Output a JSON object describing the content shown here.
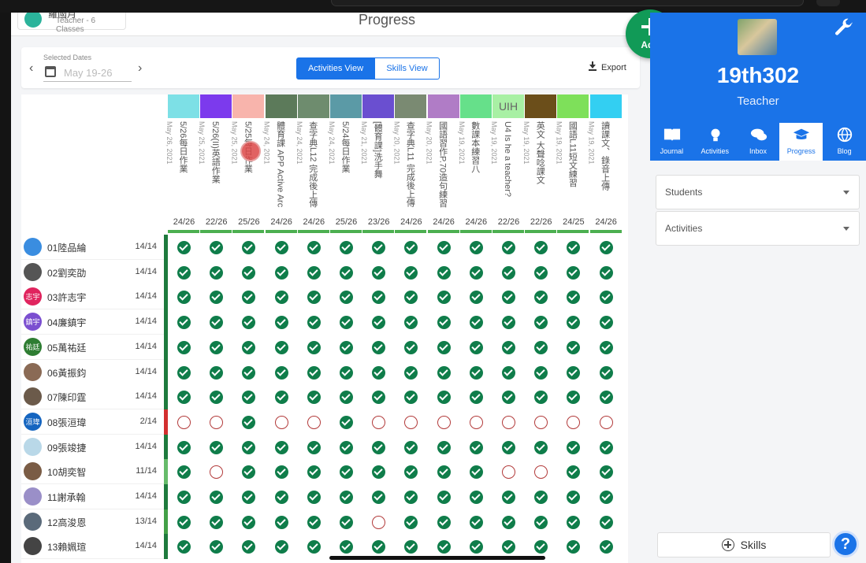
{
  "header": {
    "teacher_name": "羅國月",
    "teacher_sub": "Teacher - 6 Classes",
    "page_title": "Progress"
  },
  "toolbar": {
    "date_label": "Selected Dates",
    "date_value": "May 19-26",
    "prev": "‹",
    "next": "›",
    "activities_view": "Activities View",
    "skills_view": "Skills View",
    "export": "Export"
  },
  "activities": [
    {
      "title": "5/26每日作業",
      "date": "May 26, 2021",
      "count": "24/26",
      "color": "#7de0e6"
    },
    {
      "title": "5/26(II)英語作業",
      "date": "May 25, 2021",
      "count": "22/26",
      "color": "#7c3aed"
    },
    {
      "title": "5/25每日作業",
      "date": "May 25, 2021",
      "count": "25/26",
      "color": "#f8b4ac"
    },
    {
      "title": "體育課 APP Active Arc",
      "date": "May 24, 2021",
      "count": "24/26",
      "color": "#5c7a5a"
    },
    {
      "title": "查字典L12 完成後上傳",
      "date": "May 24, 2021",
      "count": "24/26",
      "color": "#6e8c6e"
    },
    {
      "title": "5/24每日作業",
      "date": "May 24, 2021",
      "count": "25/26",
      "color": "#5b9aa6"
    },
    {
      "title": "[體育課]洗手舞",
      "date": "May 21, 2021",
      "count": "23/26",
      "color": "#6a4fd0"
    },
    {
      "title": "查字典L11 完成後上傳",
      "date": "May 20, 2021",
      "count": "24/26",
      "color": "#7a8a72"
    },
    {
      "title": "國語習作P.70造句練習",
      "date": "May 20, 2021",
      "count": "24/26",
      "color": "#b07cc6"
    },
    {
      "title": "數課本練習八",
      "date": "May 19, 2021",
      "count": "24/26",
      "color": "#66e08a"
    },
    {
      "title": "U4 Is he a teacher?",
      "date": "May 19, 2021",
      "count": "22/26",
      "color": "#a8f0a4",
      "swatch_text": "UIH"
    },
    {
      "title": "英文 大聲唸課文",
      "date": "May 19, 2021",
      "count": "22/26",
      "color": "#6b4e1a"
    },
    {
      "title": "國語L11短文練習",
      "date": "May 19, 2021",
      "count": "24/25",
      "color": "#7ee05a"
    },
    {
      "title": "讀課文、錄音上傳",
      "date": "May 19, 2021",
      "count": "24/26",
      "color": "#33cff2"
    }
  ],
  "students": [
    {
      "name": "01陸品綸",
      "score": "14/14",
      "initials": "",
      "ava_color": "#3a8de0",
      "bar": "#1e7a3d",
      "marks": [
        1,
        1,
        1,
        1,
        1,
        1,
        1,
        1,
        1,
        1,
        1,
        1,
        1,
        1
      ]
    },
    {
      "name": "02劉奕劭",
      "score": "14/14",
      "initials": "",
      "ava_color": "#555555",
      "bar": "#1e7a3d",
      "marks": [
        1,
        1,
        1,
        1,
        1,
        1,
        1,
        1,
        1,
        1,
        1,
        1,
        1,
        1
      ]
    },
    {
      "name": "03許志宇",
      "score": "14/14",
      "initials": "志宇",
      "ava_color": "#e0245e",
      "bar": "#1e7a3d",
      "marks": [
        1,
        1,
        1,
        1,
        1,
        1,
        1,
        1,
        1,
        1,
        1,
        1,
        1,
        1
      ]
    },
    {
      "name": "04廉鎮宇",
      "score": "14/14",
      "initials": "鎮宇",
      "ava_color": "#7b4fd0",
      "bar": "#1e7a3d",
      "marks": [
        1,
        1,
        1,
        1,
        1,
        1,
        1,
        1,
        1,
        1,
        1,
        1,
        1,
        1
      ]
    },
    {
      "name": "05萬祐廷",
      "score": "14/14",
      "initials": "祐廷",
      "ava_color": "#2e7d32",
      "bar": "#1e7a3d",
      "marks": [
        1,
        1,
        1,
        1,
        1,
        1,
        1,
        1,
        1,
        1,
        1,
        1,
        1,
        1
      ]
    },
    {
      "name": "06黃振鈞",
      "score": "14/14",
      "initials": "",
      "ava_color": "#8a6a55",
      "bar": "#1e7a3d",
      "marks": [
        1,
        1,
        1,
        1,
        1,
        1,
        1,
        1,
        1,
        1,
        1,
        1,
        1,
        1
      ]
    },
    {
      "name": "07陳印霆",
      "score": "14/14",
      "initials": "",
      "ava_color": "#6b5a4a",
      "bar": "#1e7a3d",
      "marks": [
        1,
        1,
        1,
        1,
        1,
        1,
        1,
        1,
        1,
        1,
        1,
        1,
        1,
        1
      ]
    },
    {
      "name": "08張洹瑋",
      "score": "2/14",
      "initials": "洹瑋",
      "ava_color": "#1565c0",
      "bar": "#d32f2f",
      "marks": [
        0,
        0,
        1,
        0,
        0,
        1,
        0,
        0,
        0,
        0,
        0,
        0,
        0,
        0
      ]
    },
    {
      "name": "09張竣捷",
      "score": "14/14",
      "initials": "",
      "ava_color": "#b9d8e8",
      "bar": "#1e7a3d",
      "marks": [
        1,
        1,
        1,
        1,
        1,
        1,
        1,
        1,
        1,
        1,
        1,
        1,
        1,
        1
      ]
    },
    {
      "name": "10胡奕智",
      "score": "11/14",
      "initials": "",
      "ava_color": "#7a5c45",
      "bar": "#66bb6a",
      "marks": [
        1,
        0,
        1,
        1,
        1,
        1,
        1,
        1,
        1,
        1,
        0,
        0,
        1,
        1
      ]
    },
    {
      "name": "11謝承翰",
      "score": "14/14",
      "initials": "",
      "ava_color": "#9a8fc8",
      "bar": "#1e7a3d",
      "marks": [
        1,
        1,
        1,
        1,
        1,
        1,
        1,
        1,
        1,
        1,
        1,
        1,
        1,
        1
      ]
    },
    {
      "name": "12高浚恩",
      "score": "13/14",
      "initials": "",
      "ava_color": "#5a6a7a",
      "bar": "#43a047",
      "marks": [
        1,
        1,
        1,
        1,
        1,
        1,
        0,
        1,
        1,
        1,
        1,
        1,
        1,
        1
      ]
    },
    {
      "name": "13賴姵瑄",
      "score": "14/14",
      "initials": "",
      "ava_color": "#444444",
      "bar": "#1e7a3d",
      "marks": [
        1,
        1,
        1,
        1,
        1,
        1,
        1,
        1,
        1,
        1,
        1,
        1,
        1,
        1
      ]
    }
  ],
  "right_panel": {
    "class_name": "19th302",
    "role": "Teacher",
    "nav": [
      {
        "label": "Journal",
        "icon": "journal-icon"
      },
      {
        "label": "Activities",
        "icon": "lightbulb-icon"
      },
      {
        "label": "Inbox",
        "icon": "chat-icon"
      },
      {
        "label": "Progress",
        "icon": "graduation-cap-icon",
        "active": true
      },
      {
        "label": "Blog",
        "icon": "globe-icon"
      }
    ],
    "students_select": "Students",
    "activities_select": "Activities",
    "skills_button": "Skills",
    "help": "?"
  },
  "fab": {
    "label": "Add"
  },
  "colors": {
    "brand_blue": "#1a73e8",
    "done_green": "#0f7d4a",
    "todo_red": "#b23a3a",
    "fab_green": "#119a57"
  }
}
